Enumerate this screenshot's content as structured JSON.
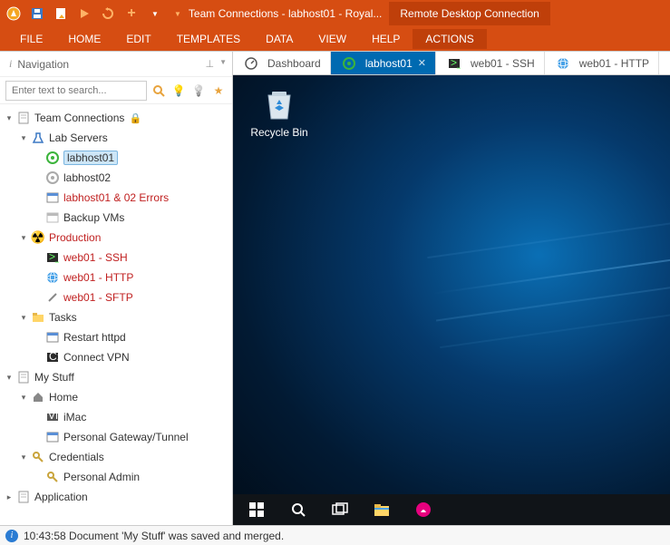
{
  "title": {
    "doc": "Team Connections - labhost01 - Royal...",
    "subtitle": "Remote Desktop Connection"
  },
  "menu": [
    "FILE",
    "HOME",
    "EDIT",
    "TEMPLATES",
    "DATA",
    "VIEW",
    "HELP",
    "ACTIONS"
  ],
  "menu_active": "ACTIONS",
  "nav": {
    "title": "Navigation",
    "search_placeholder": "Enter text to search..."
  },
  "tree": [
    {
      "depth": 0,
      "exp": "▾",
      "icon": "document",
      "label": "Team Connections",
      "trail": "lock",
      "red": false
    },
    {
      "depth": 1,
      "exp": "▾",
      "icon": "flask",
      "label": "Lab Servers",
      "red": false
    },
    {
      "depth": 2,
      "exp": "",
      "icon": "conn-green",
      "label": "labhost01",
      "red": false,
      "selected": true
    },
    {
      "depth": 2,
      "exp": "",
      "icon": "conn-grey",
      "label": "labhost02",
      "red": false
    },
    {
      "depth": 2,
      "exp": "",
      "icon": "task",
      "label": "labhost01 & 02 Errors",
      "red": true
    },
    {
      "depth": 2,
      "exp": "",
      "icon": "task-grey",
      "label": "Backup VMs",
      "red": false
    },
    {
      "depth": 1,
      "exp": "▾",
      "icon": "radiation",
      "label": "Production",
      "red": true
    },
    {
      "depth": 2,
      "exp": "",
      "icon": "terminal",
      "label": "web01 - SSH",
      "red": true
    },
    {
      "depth": 2,
      "exp": "",
      "icon": "globe",
      "label": "web01 - HTTP",
      "red": true
    },
    {
      "depth": 2,
      "exp": "",
      "icon": "tools",
      "label": "web01 - SFTP",
      "red": true
    },
    {
      "depth": 1,
      "exp": "▾",
      "icon": "folder",
      "label": "Tasks",
      "red": false
    },
    {
      "depth": 2,
      "exp": "",
      "icon": "task",
      "label": "Restart httpd",
      "red": false
    },
    {
      "depth": 2,
      "exp": "",
      "icon": "terminal-dark",
      "label": "Connect VPN",
      "red": false
    },
    {
      "depth": 0,
      "exp": "▾",
      "icon": "document",
      "label": "My Stuff",
      "red": false
    },
    {
      "depth": 1,
      "exp": "▾",
      "icon": "home",
      "label": "Home",
      "red": false
    },
    {
      "depth": 2,
      "exp": "",
      "icon": "vnc",
      "label": "iMac",
      "red": false
    },
    {
      "depth": 2,
      "exp": "",
      "icon": "task",
      "label": "Personal Gateway/Tunnel",
      "red": false
    },
    {
      "depth": 1,
      "exp": "▾",
      "icon": "key",
      "label": "Credentials",
      "red": false
    },
    {
      "depth": 2,
      "exp": "",
      "icon": "key",
      "label": "Personal Admin",
      "red": false
    },
    {
      "depth": 0,
      "exp": "▸",
      "icon": "document",
      "label": "Application",
      "red": false
    }
  ],
  "tabs": [
    {
      "icon": "gauge",
      "label": "Dashboard",
      "active": false,
      "closable": false
    },
    {
      "icon": "conn-green",
      "label": "labhost01",
      "active": true,
      "closable": true
    },
    {
      "icon": "terminal",
      "label": "web01 - SSH",
      "active": false,
      "closable": false
    },
    {
      "icon": "globe",
      "label": "web01 - HTTP",
      "active": false,
      "closable": false
    }
  ],
  "desktop": {
    "recycle_label": "Recycle Bin"
  },
  "status": {
    "text": "10:43:58 Document 'My Stuff' was saved and merged."
  },
  "icons": {
    "lock": "🔒",
    "flask": "⚗",
    "radiation": "☢",
    "folder": "📁",
    "home": "🏠",
    "key": "🔑",
    "bulb": "💡",
    "star": "★",
    "pin": "📌"
  }
}
